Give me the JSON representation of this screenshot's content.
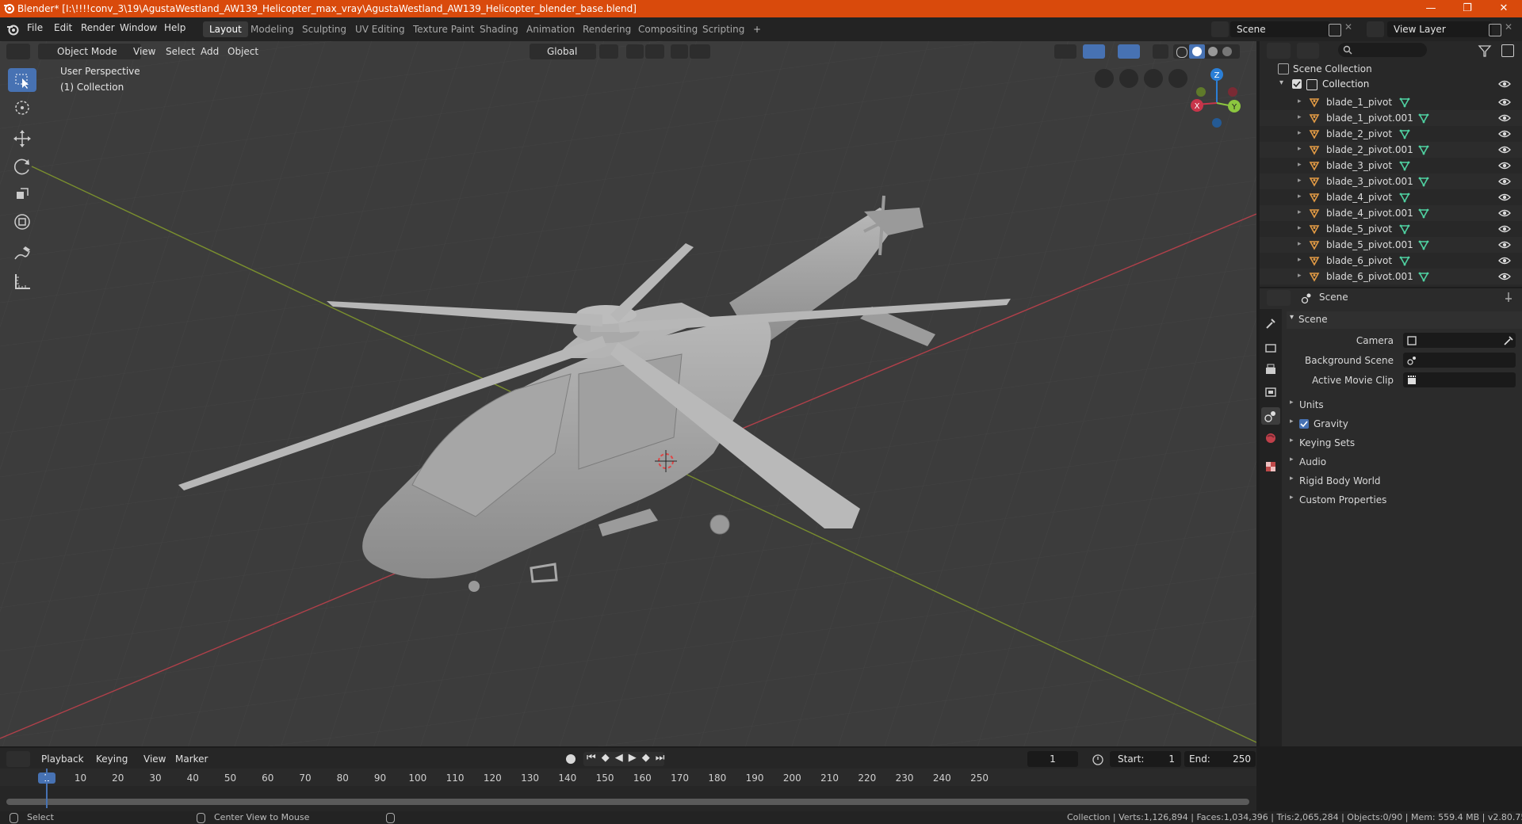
{
  "window": {
    "title": "Blender* [I:\\!!!!conv_3\\19\\AgustaWestland_AW139_Helicopter_max_vray\\AgustaWestland_AW139_Helicopter_blender_base.blend]",
    "minimize": "—",
    "maximize": "❐",
    "close": "✕"
  },
  "menu": {
    "items": [
      "File",
      "Edit",
      "Render",
      "Window",
      "Help"
    ]
  },
  "workspaces": {
    "tabs": [
      "Layout",
      "Modeling",
      "Sculpting",
      "UV Editing",
      "Texture Paint",
      "Shading",
      "Animation",
      "Rendering",
      "Compositing",
      "Scripting"
    ],
    "active": "Layout",
    "add": "+"
  },
  "scene_selector": {
    "value": "Scene"
  },
  "view_layer_selector": {
    "value": "View Layer"
  },
  "viewport_header": {
    "mode": "Object Mode",
    "menus": [
      "View",
      "Select",
      "Add",
      "Object"
    ],
    "transform_orientation": "Global"
  },
  "viewport": {
    "perspective": "User Perspective",
    "collection": "(1) Collection",
    "gizmo": {
      "z": "Z",
      "y": "Y",
      "x": "X"
    }
  },
  "outliner": {
    "root": "Scene Collection",
    "collection": "Collection",
    "items": [
      "blade_1_pivot",
      "blade_1_pivot.001",
      "blade_2_pivot",
      "blade_2_pivot.001",
      "blade_3_pivot",
      "blade_3_pivot.001",
      "blade_4_pivot",
      "blade_4_pivot.001",
      "blade_5_pivot",
      "blade_5_pivot.001",
      "blade_6_pivot",
      "blade_6_pivot.001"
    ]
  },
  "properties": {
    "header": "Scene",
    "panel": "Scene",
    "fields": [
      {
        "label": "Camera"
      },
      {
        "label": "Background Scene"
      },
      {
        "label": "Active Movie Clip"
      }
    ],
    "sections": [
      "Units",
      "Gravity",
      "Keying Sets",
      "Audio",
      "Rigid Body World",
      "Custom Properties"
    ],
    "gravity_checked": true
  },
  "timeline": {
    "menus": [
      "Playback",
      "Keying",
      "View",
      "Marker"
    ],
    "current_frame": "1",
    "start_label": "Start:",
    "start": "1",
    "end_label": "End:",
    "end": "250",
    "ruler": [
      "1",
      "10",
      "20",
      "30",
      "40",
      "50",
      "60",
      "70",
      "80",
      "90",
      "100",
      "110",
      "120",
      "130",
      "140",
      "150",
      "160",
      "170",
      "180",
      "190",
      "200",
      "210",
      "220",
      "230",
      "240",
      "250"
    ]
  },
  "statusbar": {
    "select": "Select",
    "center_view": "Center View to Mouse",
    "stats": "Collection | Verts:1,126,894 | Faces:1,034,396 | Tris:2,065,284 | Objects:0/90 | Mem: 559.4 MB | v2.80.75"
  },
  "colors": {
    "titlebar": "#d94a0c",
    "accent": "#4772b3",
    "x_axis": "#c8354a",
    "y_axis": "#8cc63f",
    "z_axis": "#2b7fd6",
    "object_icon": "#e39b45",
    "mesh_icon": "#4fd1a1"
  }
}
